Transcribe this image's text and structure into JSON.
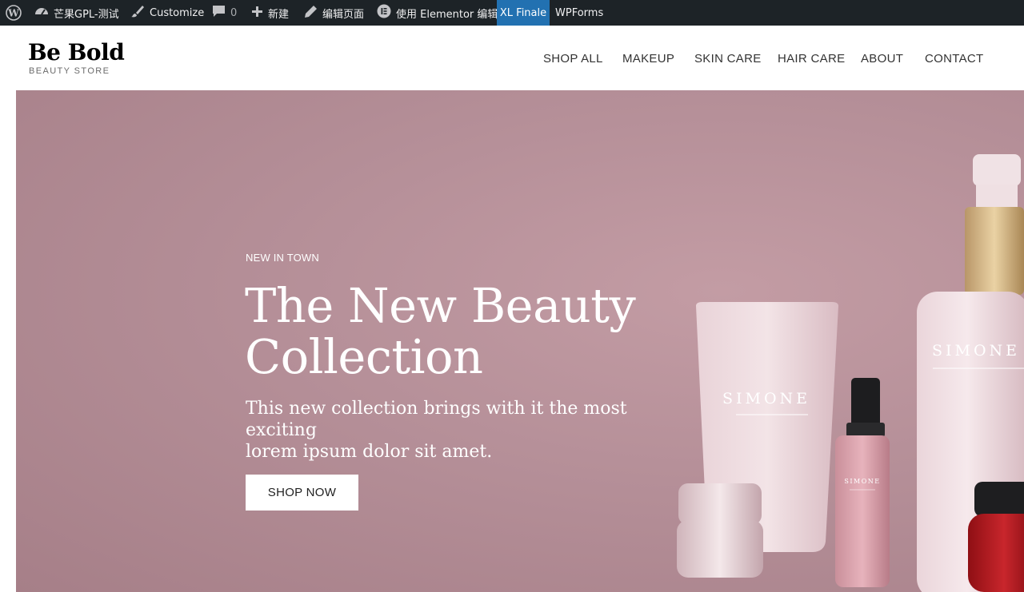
{
  "adminbar": {
    "site_name": "芒果GPL-测试",
    "customize": "Customize",
    "comments_count": "0",
    "new": "新建",
    "edit_page": "编辑页面",
    "elementor_edit": "使用 Elementor 编辑",
    "xl_finale": "XL Finale",
    "wpforms": "WPForms"
  },
  "brand": {
    "title": "Be Bold",
    "subtitle": "BEAUTY STORE"
  },
  "nav": {
    "shop_all": "SHOP ALL",
    "makeup": "MAKEUP",
    "skin_care": "SKIN CARE",
    "hair_care": "HAIR CARE",
    "about": "ABOUT",
    "contact": "CONTACT"
  },
  "hero": {
    "eyebrow": "NEW IN TOWN",
    "title_line1": "The New Beauty",
    "title_line2": "Collection",
    "text_line1": "This new collection brings with it the most exciting",
    "text_line2": "lorem ipsum dolor sit amet.",
    "cta": "SHOP NOW",
    "product_label": "SIMONE"
  },
  "colors": {
    "adminbar_bg": "#1d2327",
    "adminbar_active": "#2271b1",
    "hero_bg": "#b58f98"
  }
}
